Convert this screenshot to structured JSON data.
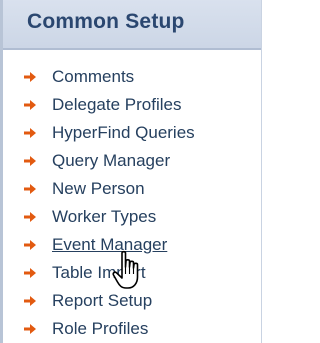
{
  "panel": {
    "title": "Common Setup",
    "accent_color": "#e25a10",
    "items": [
      {
        "label": "Comments"
      },
      {
        "label": "Delegate Profiles"
      },
      {
        "label": "HyperFind Queries"
      },
      {
        "label": "Query Manager"
      },
      {
        "label": "New Person"
      },
      {
        "label": "Worker Types"
      },
      {
        "label": "Event Manager",
        "hovered": true
      },
      {
        "label": "Table Import"
      },
      {
        "label": "Report Setup"
      },
      {
        "label": "Role Profiles"
      }
    ]
  },
  "cursor": {
    "icon": "hand-pointer-icon"
  }
}
